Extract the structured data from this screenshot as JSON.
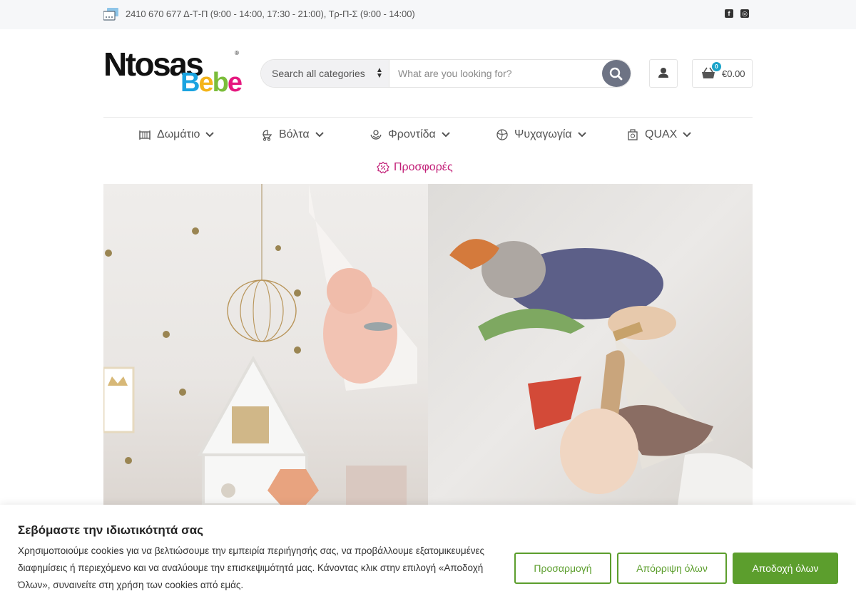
{
  "topbar": {
    "phone_icon": "phone-card-icon",
    "phone_text": "2410 670 677 Δ-Τ-Π (9:00 - 14:00, 17:30 - 21:00), Τρ-Π-Σ (9:00 - 14:00)",
    "social": [
      {
        "name": "facebook-icon",
        "glyph": "f"
      },
      {
        "name": "instagram-icon",
        "glyph": "◎"
      }
    ]
  },
  "logo": {
    "word1": "Ntosas",
    "reg_mark": "®",
    "word2_letters": [
      {
        "char": "B",
        "color": "#1aa3e0"
      },
      {
        "char": "e",
        "color": "#f4b41a"
      },
      {
        "char": "b",
        "color": "#7bbd3a"
      },
      {
        "char": "e",
        "color": "#e5197f"
      }
    ]
  },
  "search": {
    "category_label": "Search all categories",
    "placeholder": "What are you looking for?",
    "button_icon": "search-icon"
  },
  "account": {
    "icon": "user-icon"
  },
  "cart": {
    "icon": "basket-icon",
    "count": "0",
    "amount": "€0.00"
  },
  "nav": {
    "items": [
      {
        "label": "Δωμάτιο",
        "icon": "crib-icon"
      },
      {
        "label": "Βόλτα",
        "icon": "stroller-icon"
      },
      {
        "label": "Φροντίδα",
        "icon": "care-hands-icon"
      },
      {
        "label": "Ψυχαγωγία",
        "icon": "ball-icon"
      },
      {
        "label": "QUAX",
        "icon": "quax-icon"
      }
    ],
    "offers": {
      "label": "Προσφορές",
      "icon": "discount-badge-icon"
    }
  },
  "colors": {
    "accent_green": "#5c9e2d",
    "offer_pink": "#c21e77",
    "badge_blue": "#1aa3c9",
    "search_button": "#6d7384"
  },
  "cookie": {
    "title": "Σεβόμαστε την ιδιωτικότητά σας",
    "body": "Χρησιμοποιούμε cookies για να βελτιώσουμε την εμπειρία περιήγησής σας, να προβάλλουμε εξατομικευμένες διαφημίσεις ή περιεχόμενο και να αναλύουμε την επισκεψιμότητά μας. Κάνοντας κλικ στην επιλογή «Αποδοχή Όλων», συναινείτε στη χρήση των cookies από εμάς.",
    "customize_label": "Προσαρμογή",
    "reject_label": "Απόρριψη όλων",
    "accept_label": "Αποδοχή όλων"
  }
}
